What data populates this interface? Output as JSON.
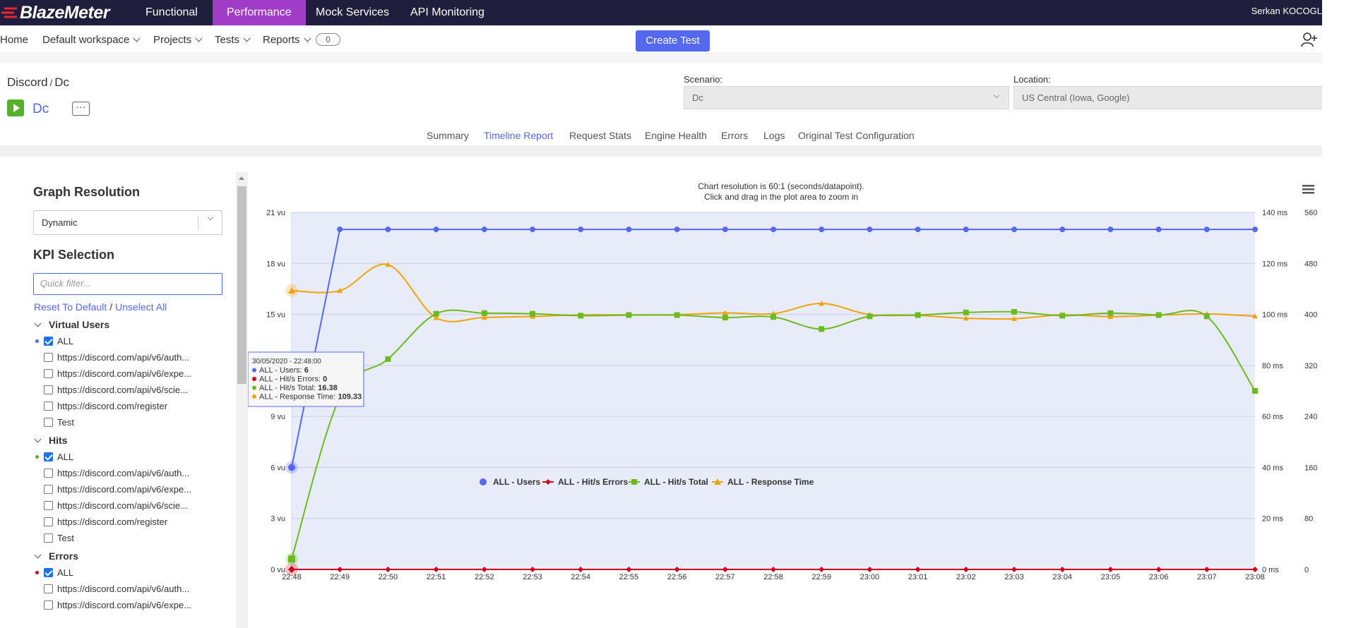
{
  "topnav": {
    "logo": "BlazeMeter",
    "items": [
      "Functional",
      "Performance",
      "Mock Services",
      "API Monitoring"
    ],
    "active": "Performance",
    "user": "Serkan KOCOGL"
  },
  "subnav": {
    "home": "Home",
    "workspace": "Default workspace",
    "projects": "Projects",
    "tests": "Tests",
    "reports": "Reports",
    "notifications": "0",
    "create_test": "Create Test"
  },
  "header": {
    "breadcrumb_project": "Discord",
    "breadcrumb_sep": "/",
    "breadcrumb_test": "Dc",
    "test_name": "Dc",
    "more": "···",
    "scenario_label": "Scenario:",
    "scenario_value": "Dc",
    "location_label": "Location:",
    "location_value": "US Central (Iowa, Google)"
  },
  "tabs": [
    "Summary",
    "Timeline Report",
    "Request Stats",
    "Engine Health",
    "Errors",
    "Logs",
    "Original Test Configuration"
  ],
  "active_tab": "Timeline Report",
  "left_panel": {
    "graph_resolution_title": "Graph Resolution",
    "resolution_value": "Dynamic",
    "kpi_title": "KPI Selection",
    "filter_placeholder": "Quick filter...",
    "reset": "Reset To Default",
    "unselect": "Unselect All",
    "groups": [
      {
        "name": "Virtual Users",
        "color": "#5468f0",
        "items": [
          "ALL",
          "https://discord.com/api/v6/auth...",
          "https://discord.com/api/v6/expe...",
          "https://discord.com/api/v6/scie...",
          "https://discord.com/register",
          "Test"
        ]
      },
      {
        "name": "Hits",
        "color": "#55b12d",
        "items": [
          "ALL",
          "https://discord.com/api/v6/auth...",
          "https://discord.com/api/v6/expe...",
          "https://discord.com/api/v6/scie...",
          "https://discord.com/register",
          "Test"
        ]
      },
      {
        "name": "Errors",
        "color": "#d0021b",
        "items": [
          "ALL",
          "https://discord.com/api/v6/auth...",
          "https://discord.com/api/v6/expe..."
        ]
      }
    ]
  },
  "chart_data": {
    "type": "line",
    "subtitle_line1": "Chart resolution is 60:1 (seconds/datapoint).",
    "subtitle_line2": "Click and drag in the plot area to zoom in",
    "categories": [
      "22:48",
      "22:49",
      "22:50",
      "22:51",
      "22:52",
      "22:53",
      "22:54",
      "22:55",
      "22:56",
      "22:57",
      "22:58",
      "22:59",
      "23:00",
      "23:01",
      "23:02",
      "23:03",
      "23:04",
      "23:05",
      "23:06",
      "23:07",
      "23:08"
    ],
    "y_left": {
      "ticks": [
        "0 vu",
        "3 vu",
        "6 vu",
        "9 vu",
        "12 vu",
        "15 vu",
        "18 vu",
        "21 vu"
      ],
      "min": 0,
      "max": 21
    },
    "y_right_ms": {
      "ticks": [
        "0 ms",
        "20 ms",
        "40 ms",
        "60 ms",
        "80 ms",
        "100 ms",
        "120 ms",
        "140 ms"
      ],
      "min": 0,
      "max": 140
    },
    "y_right_hits": {
      "ticks": [
        "0",
        "80",
        "160",
        "240",
        "320",
        "400",
        "480",
        "560"
      ],
      "min": 0,
      "max": 560
    },
    "series": [
      {
        "name": "ALL - Users",
        "color": "#5468f0",
        "marker": "circle",
        "axis": "left",
        "values": [
          6,
          20,
          20,
          20,
          20,
          20,
          20,
          20,
          20,
          20,
          20,
          20,
          20,
          20,
          20,
          20,
          20,
          20,
          20,
          20,
          20
        ]
      },
      {
        "name": "ALL - Hit/s Errors",
        "color": "#d0021b",
        "marker": "diamond",
        "axis": "left",
        "values": [
          0,
          0,
          0,
          0,
          0,
          0,
          0,
          0,
          0,
          0,
          0,
          0,
          0,
          0,
          0,
          0,
          0,
          0,
          0,
          0,
          0
        ]
      },
      {
        "name": "ALL - Hit/s Total",
        "color": "#6cbb1e",
        "marker": "square",
        "axis": "hits",
        "values": [
          16.38,
          270,
          330,
          401,
          402,
          401,
          398,
          399,
          399,
          395,
          396,
          377,
          397,
          399,
          403,
          404,
          398,
          402,
          399,
          397,
          280
        ]
      },
      {
        "name": "ALL - Response Time",
        "color": "#f0a30a",
        "marker": "triangle",
        "axis": "ms",
        "values": [
          109.33,
          109.3,
          119.5,
          98.7,
          98.8,
          99.2,
          99.8,
          99.8,
          99.9,
          100.6,
          100.3,
          104.3,
          99.9,
          99.6,
          98.5,
          98.3,
          99.8,
          99.1,
          99.7,
          100.2,
          99.3
        ]
      }
    ],
    "tooltip": {
      "title": "30/05/2020 - 22:48:00",
      "rows": [
        {
          "label": "ALL - Users: ",
          "value": "6",
          "color": "#5468f0"
        },
        {
          "label": "ALL - Hit/s Errors: ",
          "value": "0",
          "color": "#d0021b"
        },
        {
          "label": "ALL - Hit/s Total: ",
          "value": "16.38",
          "color": "#6cbb1e"
        },
        {
          "label": "ALL - Response Time: ",
          "value": "109.33",
          "color": "#f0a30a"
        }
      ]
    }
  }
}
